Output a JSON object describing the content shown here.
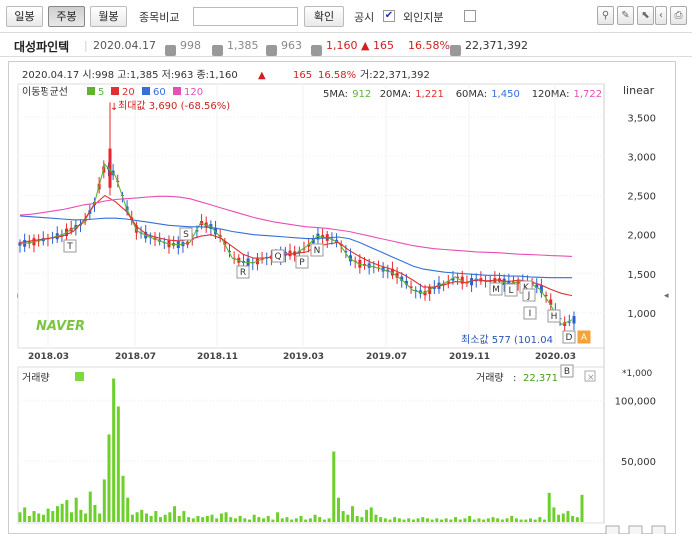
{
  "toolbar": {
    "period_buttons": [
      "일봉",
      "주봉",
      "월봉"
    ],
    "active_period": "주봉",
    "compare_label": "종목비교",
    "compare_input_value": "",
    "confirm_label": "확인",
    "disclosure_label": "공시",
    "disclosure_checked": true,
    "foreign_label": "외인지분",
    "foreign_checked": false,
    "right_icons": [
      "pin-icon",
      "pencil-icon",
      "cursor-icon",
      "arrow-left-icon",
      "print-icon"
    ]
  },
  "info": {
    "name": "대성파인텍",
    "date": "2020.04.17",
    "open": "998",
    "high": "1,385",
    "low": "963",
    "close": "1,160",
    "change": "▲ 165",
    "pct": "16.58%",
    "volume": "22,371,392",
    "badges": [
      "시",
      "고",
      "저",
      "종",
      "거"
    ]
  },
  "chart_header": {
    "summary_prefix": "2020.04.17 시:998 고:1,385 저:963 종:1,160",
    "summary_arrow": "▲",
    "summary_change": "165",
    "summary_pct": "16.58%",
    "summary_volume": "거:22,371,392"
  },
  "ma_legend": {
    "title": "이동평균선",
    "items": [
      {
        "label": "5",
        "color": "#5cb531"
      },
      {
        "label": "20",
        "color": "#e03030"
      },
      {
        "label": "60",
        "color": "#3570d8"
      },
      {
        "label": "120",
        "color": "#e84fb6"
      }
    ],
    "values": [
      {
        "label": "5MA:",
        "value": "912",
        "color": "#5cb531"
      },
      {
        "label": "20MA:",
        "value": "1,221",
        "color": "#e03030"
      },
      {
        "label": "60MA:",
        "value": "1,450",
        "color": "#3570d8"
      },
      {
        "label": "120MA:",
        "value": "1,722",
        "color": "#e84fb6"
      }
    ],
    "scale_mode": "linear"
  },
  "annotations": {
    "max_label": "최대값 3,690 (-68.56%)",
    "min_label": "최소값 577 (101.04",
    "watermark": "NAVER",
    "event_markers": [
      "T",
      "S",
      "R",
      "Q",
      "P",
      "N",
      "M",
      "L",
      "K",
      "J",
      "I",
      "H",
      "D",
      "B",
      "A"
    ]
  },
  "chart_data": [
    {
      "type": "line",
      "ylim": [
        577,
        3900
      ],
      "y_ticks": [
        "3,500",
        "3,000",
        "2,500",
        "2,000",
        "1,500",
        "1,000"
      ],
      "x_ticks": [
        "2018.03",
        "2018.07",
        "2018.11",
        "2019.03",
        "2019.07",
        "2019.11",
        "2020.03"
      ],
      "series": [
        {
          "name": "5",
          "color": "#5cb531",
          "values": [
            1880,
            1900,
            1930,
            1960,
            2000,
            2080,
            2150,
            2400,
            2900,
            2750,
            2350,
            2050,
            1980,
            1930,
            1880,
            1870,
            1900,
            2150,
            2100,
            1950,
            1700,
            1650,
            1640,
            1700,
            1720,
            1760,
            1760,
            1850,
            1980,
            1960,
            1900,
            1700,
            1620,
            1600,
            1560,
            1520,
            1420,
            1290,
            1250,
            1330,
            1380,
            1460,
            1380,
            1430,
            1400,
            1420,
            1370,
            1400,
            1380,
            1300,
            1100,
            850,
            912
          ]
        },
        {
          "name": "20",
          "color": "#e03030",
          "values": [
            1900,
            1920,
            1940,
            1960,
            1980,
            2040,
            2180,
            2380,
            2500,
            2420,
            2300,
            2100,
            2000,
            1960,
            1930,
            1920,
            1940,
            1980,
            2000,
            1950,
            1850,
            1750,
            1700,
            1700,
            1720,
            1740,
            1760,
            1780,
            1850,
            1880,
            1900,
            1800,
            1720,
            1650,
            1600,
            1560,
            1500,
            1420,
            1330,
            1330,
            1360,
            1400,
            1390,
            1420,
            1410,
            1420,
            1400,
            1420,
            1400,
            1360,
            1300,
            1250,
            1221
          ]
        },
        {
          "name": "60",
          "color": "#3570d8",
          "values": [
            2240,
            2230,
            2220,
            2210,
            2200,
            2190,
            2190,
            2200,
            2210,
            2210,
            2200,
            2180,
            2160,
            2140,
            2120,
            2110,
            2100,
            2100,
            2090,
            2070,
            2040,
            2020,
            2000,
            1990,
            1980,
            1970,
            1960,
            1950,
            1950,
            1960,
            1970,
            1950,
            1900,
            1840,
            1780,
            1720,
            1660,
            1600,
            1560,
            1540,
            1520,
            1510,
            1500,
            1490,
            1480,
            1480,
            1470,
            1470,
            1460,
            1455,
            1450,
            1450,
            1450
          ]
        },
        {
          "name": "120",
          "color": "#e84fb6",
          "values": [
            2250,
            2260,
            2280,
            2300,
            2320,
            2350,
            2380,
            2400,
            2430,
            2450,
            2460,
            2470,
            2480,
            2490,
            2490,
            2480,
            2460,
            2420,
            2380,
            2340,
            2300,
            2260,
            2220,
            2190,
            2160,
            2140,
            2120,
            2100,
            2090,
            2080,
            2060,
            2040,
            2010,
            1980,
            1950,
            1920,
            1890,
            1860,
            1840,
            1820,
            1810,
            1800,
            1790,
            1780,
            1775,
            1770,
            1760,
            1750,
            1745,
            1740,
            1732,
            1728,
            1722
          ]
        }
      ]
    },
    {
      "type": "bar",
      "title": "거래량",
      "ylim": [
        0,
        125000
      ],
      "y_ticks": [
        "100,000",
        "50,000"
      ],
      "unit": "*1,000",
      "last_value": "22,371",
      "values": [
        8000,
        12000,
        5000,
        9000,
        7000,
        6000,
        11000,
        9000,
        13000,
        15000,
        18000,
        8000,
        20000,
        10000,
        7000,
        25000,
        14000,
        7000,
        35000,
        72000,
        118000,
        95000,
        38000,
        20000,
        6000,
        8000,
        10000,
        7000,
        5000,
        9000,
        4000,
        6000,
        8000,
        13000,
        5000,
        9000,
        4000,
        3000,
        5000,
        4000,
        5000,
        6000,
        3000,
        7000,
        8000,
        4000,
        3000,
        5000,
        3000,
        2000,
        6000,
        4000,
        3000,
        5000,
        2000,
        8000,
        3000,
        4000,
        2000,
        3000,
        5000,
        2000,
        3000,
        6000,
        4000,
        2000,
        3000,
        58000,
        20000,
        9000,
        6000,
        13000,
        5000,
        4000,
        10000,
        12000,
        6000,
        4000,
        3000,
        2000,
        4000,
        3000,
        2000,
        3000,
        2000,
        3000,
        4000,
        3000,
        2000,
        3000,
        2000,
        3000,
        2000,
        4000,
        2000,
        3000,
        5000,
        2000,
        3000,
        2000,
        3000,
        4000,
        3000,
        2000,
        3000,
        5000,
        3000,
        2000,
        2000,
        3000,
        2000,
        4000,
        2000,
        24000,
        12000,
        6000,
        7000,
        9000,
        5000,
        4000,
        22371
      ]
    }
  ]
}
